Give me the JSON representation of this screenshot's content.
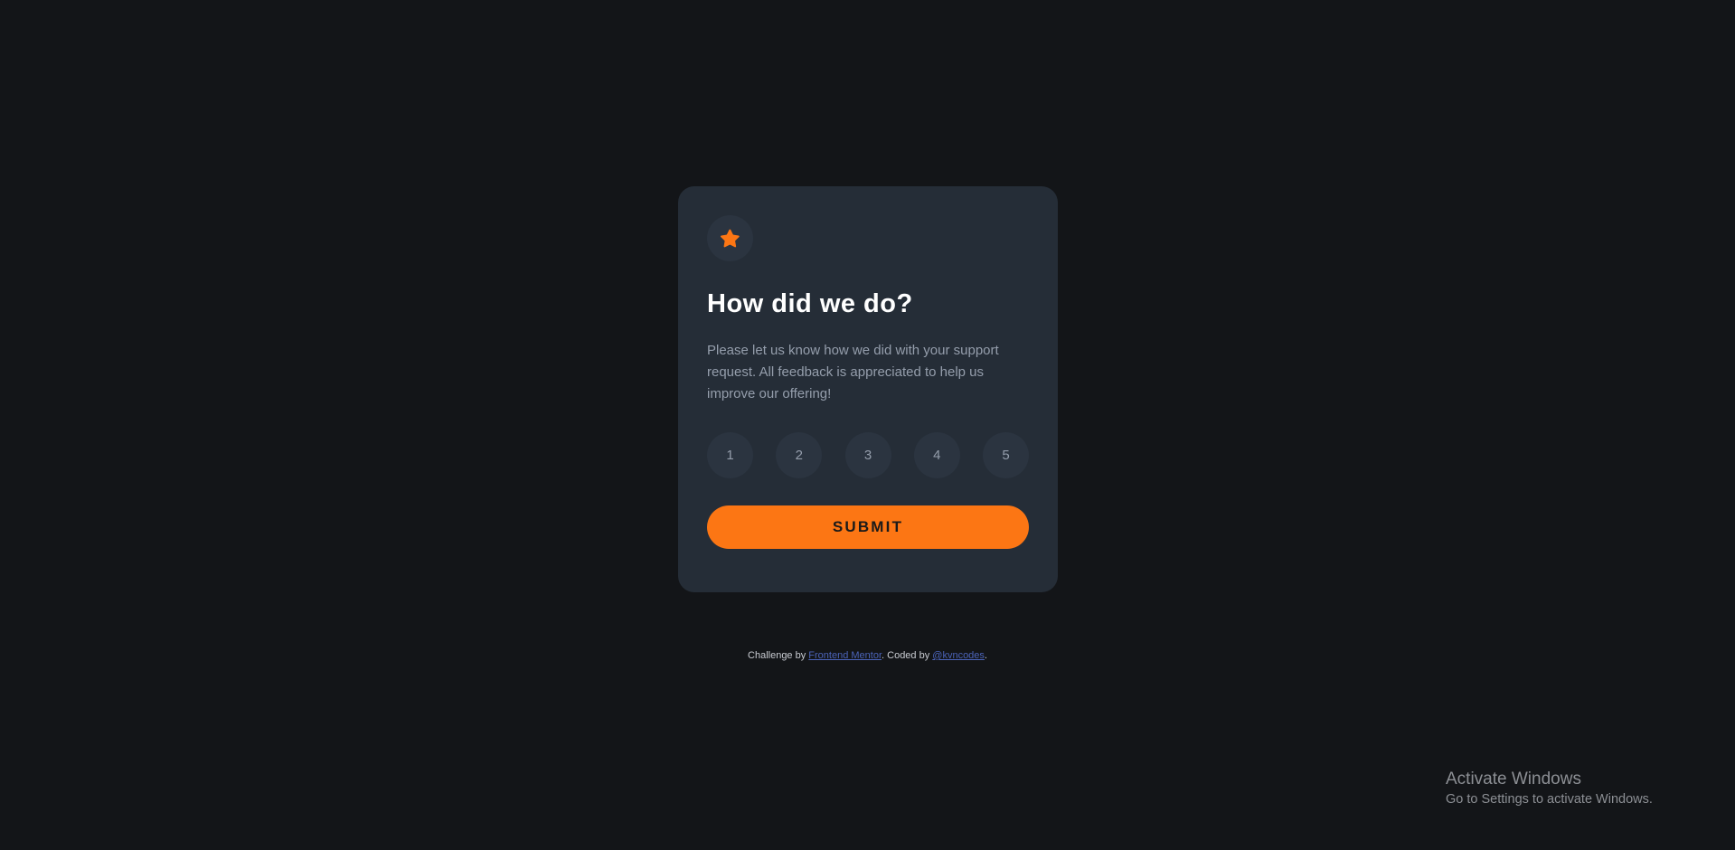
{
  "card": {
    "icon": "star-icon",
    "title": "How did we do?",
    "description": "Please let us know how we did with your support request. All feedback is appreciated to help us improve our offering!",
    "ratings": [
      "1",
      "2",
      "3",
      "4",
      "5"
    ],
    "submit_label": "SUBMIT"
  },
  "attribution": {
    "prefix": "Challenge by ",
    "link1": "Frontend Mentor",
    "middle": ". Coded by ",
    "link2": "@kvncodes",
    "suffix": "."
  },
  "watermark": {
    "title": "Activate Windows",
    "subtitle": "Go to Settings to activate Windows."
  },
  "colors": {
    "background": "#131518",
    "card": "#252d37",
    "accent": "#fc7614",
    "muted_text": "#959eac",
    "link": "#4b63b8"
  }
}
